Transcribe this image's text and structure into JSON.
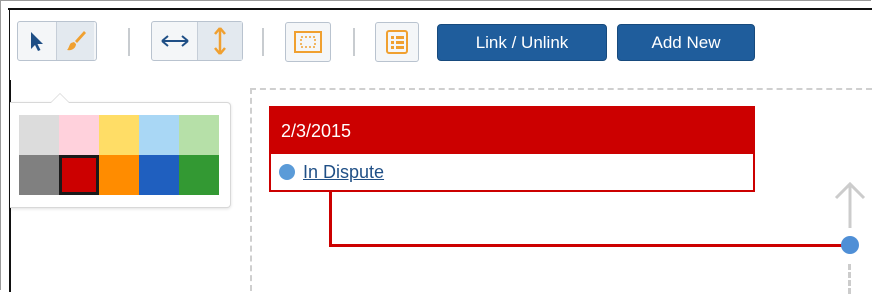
{
  "toolbar": {
    "select_tool": "arrow-pointer-icon",
    "brush_tool": "paintbrush-icon",
    "horizontal_tool": "horizontal-resize-icon",
    "vertical_tool": "vertical-resize-icon",
    "layout_tool": "frame-layout-icon",
    "list_tool": "list-view-icon",
    "link_label": "Link / Unlink",
    "add_label": "Add New"
  },
  "palette": {
    "row1": [
      "#dcdcdc",
      "#ffd1dc",
      "#ffdd66",
      "#a9d7f5",
      "#b6e0a8"
    ],
    "row2": [
      "#808080",
      "#cc0000",
      "#ff8c00",
      "#1f5fbf",
      "#339933"
    ],
    "selected": "#cc0000"
  },
  "card": {
    "date": "2/3/2015",
    "status": "In Dispute",
    "color": "#cc0000"
  },
  "colors": {
    "accent_blue": "#1f5d9c",
    "icon_orange": "#f0a030",
    "node_blue": "#4f8fd6"
  }
}
